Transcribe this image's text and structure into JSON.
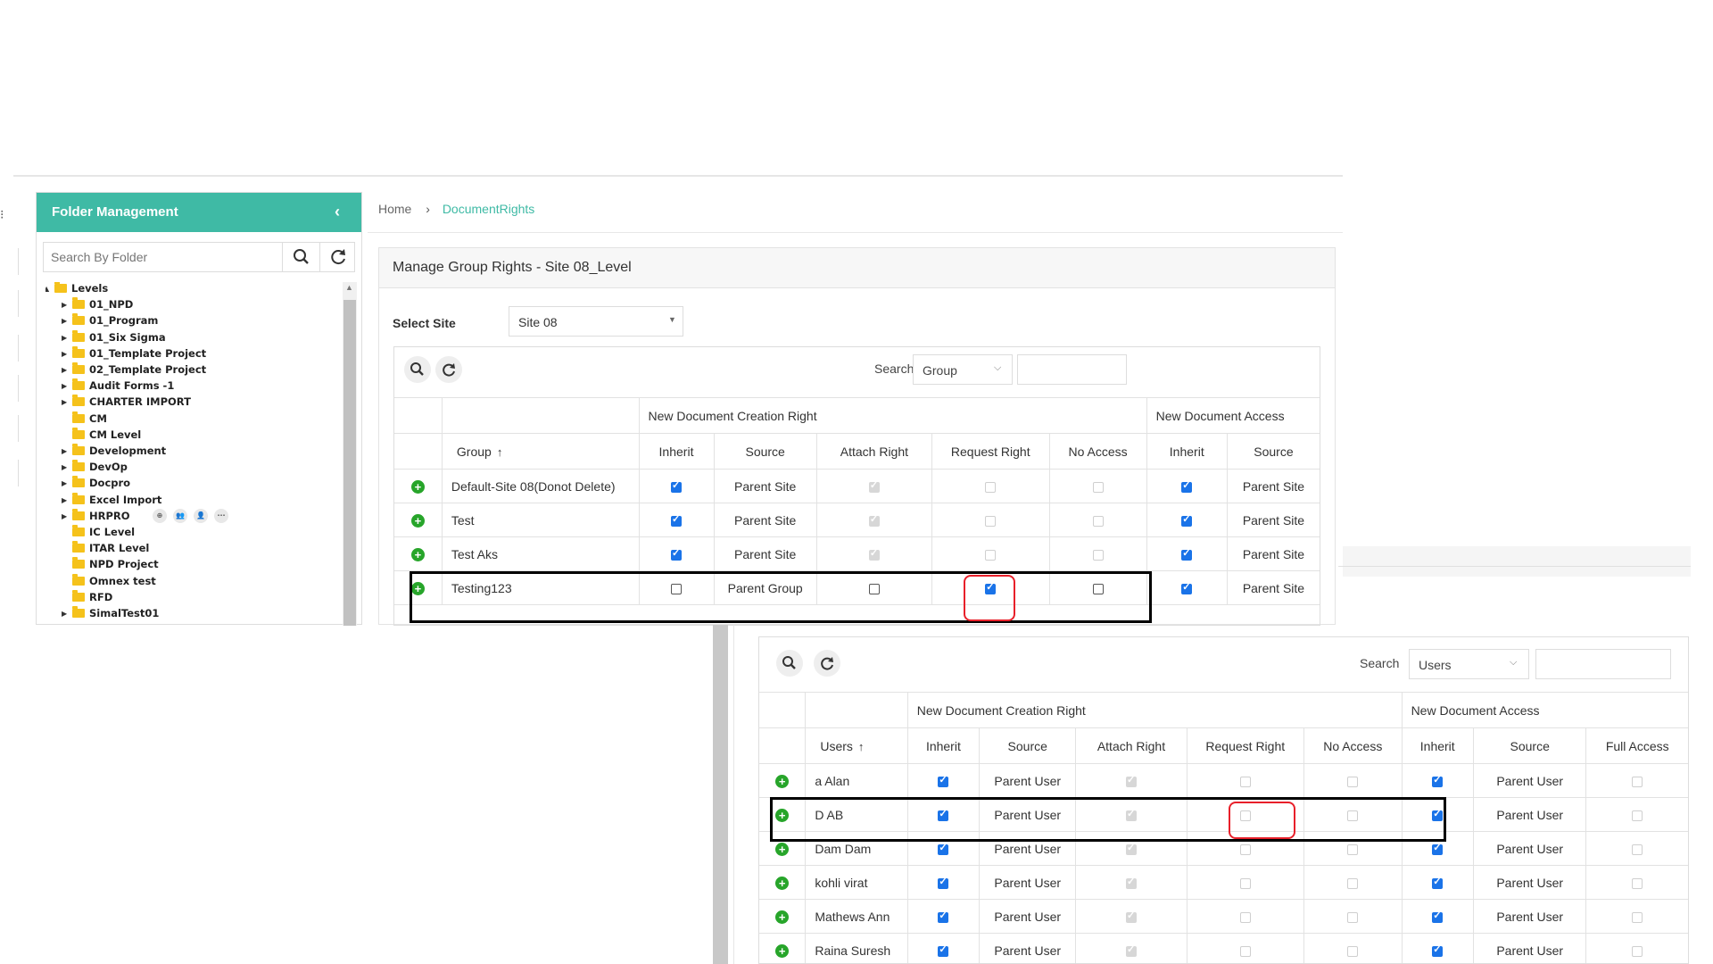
{
  "folder_panel": {
    "title": "Folder Management",
    "search_placeholder": "Search By Folder",
    "tree": [
      {
        "label": "Levels",
        "depth": 0,
        "toggle": "▲"
      },
      {
        "label": "01_NPD",
        "depth": 1,
        "toggle": "▶"
      },
      {
        "label": "01_Program",
        "depth": 1,
        "toggle": "▶"
      },
      {
        "label": "01_Six Sigma",
        "depth": 1,
        "toggle": "▶"
      },
      {
        "label": "01_Template Project",
        "depth": 1,
        "toggle": "▶"
      },
      {
        "label": "02_Template Project",
        "depth": 1,
        "toggle": "▶"
      },
      {
        "label": "Audit Forms -1",
        "depth": 1,
        "toggle": "▶"
      },
      {
        "label": "CHARTER IMPORT",
        "depth": 1,
        "toggle": "▶"
      },
      {
        "label": "CM",
        "depth": 1,
        "toggle": ""
      },
      {
        "label": "CM Level",
        "depth": 1,
        "toggle": ""
      },
      {
        "label": "Development",
        "depth": 1,
        "toggle": "▶"
      },
      {
        "label": "DevOp",
        "depth": 1,
        "toggle": "▶"
      },
      {
        "label": "Docpro",
        "depth": 1,
        "toggle": "▶"
      },
      {
        "label": "Excel Import",
        "depth": 1,
        "toggle": "▶"
      },
      {
        "label": "HRPRO",
        "depth": 1,
        "toggle": "▶"
      },
      {
        "label": "IC Level",
        "depth": 1,
        "toggle": ""
      },
      {
        "label": "ITAR Level",
        "depth": 1,
        "toggle": ""
      },
      {
        "label": "NPD Project",
        "depth": 1,
        "toggle": ""
      },
      {
        "label": "Omnex test",
        "depth": 1,
        "toggle": ""
      },
      {
        "label": "RFD",
        "depth": 1,
        "toggle": ""
      },
      {
        "label": "SimalTest01",
        "depth": 1,
        "toggle": "▶"
      }
    ],
    "hover_actions": [
      "⊕",
      "👥",
      "👤",
      "···"
    ]
  },
  "breadcrumb": {
    "home": "Home",
    "sep": "›",
    "current": "DocumentRights"
  },
  "group_rights": {
    "title": "Manage Group Rights - Site 08_Level",
    "select_site_label": "Select Site",
    "selected_site": "Site 08",
    "search_label": "Search",
    "search_field": "Group",
    "header_groups": [
      "New Document Creation Right",
      "New Document Access"
    ],
    "columns": [
      "Group",
      "Inherit",
      "Source",
      "Attach Right",
      "Request Right",
      "No Access",
      "Inherit",
      "Source"
    ],
    "sort_glyph": "↑",
    "rows": [
      {
        "name": "Default-Site 08(Donot Delete)",
        "inherit": "on",
        "source": "Parent Site",
        "attach": "dis-on",
        "request": "dis-off",
        "noaccess": "dis-off",
        "acc_inherit": "on",
        "acc_source": "Parent Site"
      },
      {
        "name": "Test",
        "inherit": "on",
        "source": "Parent Site",
        "attach": "dis-on",
        "request": "dis-off",
        "noaccess": "dis-off",
        "acc_inherit": "on",
        "acc_source": "Parent Site"
      },
      {
        "name": "Test Aks",
        "inherit": "on",
        "source": "Parent Site",
        "attach": "dis-on",
        "request": "dis-off",
        "noaccess": "dis-off",
        "acc_inherit": "on",
        "acc_source": "Parent Site"
      },
      {
        "name": "Testing123",
        "inherit": "off",
        "source": "Parent Group",
        "attach": "off",
        "request": "on",
        "noaccess": "off",
        "acc_inherit": "on",
        "acc_source": "Parent Site"
      }
    ]
  },
  "user_rights": {
    "search_label": "Search",
    "search_field": "Users",
    "header_groups": [
      "New Document Creation Right",
      "New Document Access"
    ],
    "columns": [
      "Users",
      "Inherit",
      "Source",
      "Attach Right",
      "Request Right",
      "No Access",
      "Inherit",
      "Source",
      "Full Access"
    ],
    "sort_glyph": "↑",
    "rows": [
      {
        "name": "a Alan",
        "inherit": "on",
        "source": "Parent User",
        "attach": "dis-on",
        "request": "dis-off",
        "noaccess": "dis-off",
        "acc_inherit": "on",
        "acc_source": "Parent User",
        "full": "dis-off"
      },
      {
        "name": "D AB",
        "inherit": "on",
        "source": "Parent User",
        "attach": "dis-on",
        "request": "dis-off",
        "noaccess": "dis-off",
        "acc_inherit": "on",
        "acc_source": "Parent User",
        "full": "dis-off"
      },
      {
        "name": "Dam Dam",
        "inherit": "on",
        "source": "Parent User",
        "attach": "dis-on",
        "request": "dis-off",
        "noaccess": "dis-off",
        "acc_inherit": "on",
        "acc_source": "Parent User",
        "full": "dis-off"
      },
      {
        "name": "kohli virat",
        "inherit": "on",
        "source": "Parent User",
        "attach": "dis-on",
        "request": "dis-off",
        "noaccess": "dis-off",
        "acc_inherit": "on",
        "acc_source": "Parent User",
        "full": "dis-off"
      },
      {
        "name": "Mathews Ann",
        "inherit": "on",
        "source": "Parent User",
        "attach": "dis-on",
        "request": "dis-off",
        "noaccess": "dis-off",
        "acc_inherit": "on",
        "acc_source": "Parent User",
        "full": "dis-off"
      },
      {
        "name": "Raina Suresh",
        "inherit": "on",
        "source": "Parent User",
        "attach": "dis-on",
        "request": "dis-off",
        "noaccess": "dis-off",
        "acc_inherit": "on",
        "acc_source": "Parent User",
        "full": "dis-off"
      }
    ]
  },
  "colors": {
    "accent": "#3fbaa5",
    "checkbox": "#1a73e8",
    "add": "#27a52a",
    "highlight_red": "#e8202a",
    "highlight_black": "#000000"
  },
  "icons": {
    "search": "search-icon",
    "refresh": "refresh-icon",
    "collapse": "chevron-left-icon",
    "add": "plus-circle-icon",
    "folder": "folder-icon"
  }
}
